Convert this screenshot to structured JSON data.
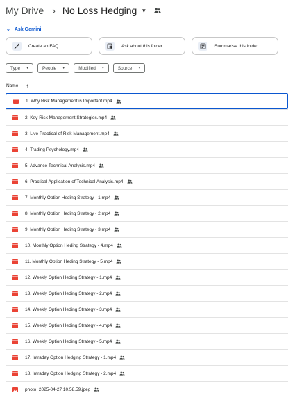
{
  "breadcrumb": {
    "root": "My Drive",
    "separator": "›",
    "current": "No Loss Hedging"
  },
  "gemini": {
    "label": "Ask Gemini"
  },
  "suggestions": [
    {
      "label": "Create an FAQ"
    },
    {
      "label": "Ask about this folder"
    },
    {
      "label": "Summarise this folder"
    }
  ],
  "filters": [
    {
      "label": "Type"
    },
    {
      "label": "People"
    },
    {
      "label": "Modified"
    },
    {
      "label": "Source"
    }
  ],
  "list_header": {
    "name_label": "Name",
    "sort": "ascending"
  },
  "files": [
    {
      "name": "1. Why Risk Management is Important.mp4",
      "kind": "video",
      "shared": true
    },
    {
      "name": "2. Key Risk Management Strategies.mp4",
      "kind": "video",
      "shared": true
    },
    {
      "name": "3. Live Practical of Risk Management.mp4",
      "kind": "video",
      "shared": true
    },
    {
      "name": "4. Trading Psychology.mp4",
      "kind": "video",
      "shared": true
    },
    {
      "name": "5. Advance Technical Analysis.mp4",
      "kind": "video",
      "shared": true
    },
    {
      "name": "6. Practical Application of Technical Analysis.mp4",
      "kind": "video",
      "shared": true
    },
    {
      "name": "7. Monthly Option Heding Strategy - 1.mp4",
      "kind": "video",
      "shared": true
    },
    {
      "name": "8. Monthly Option Heding Strategy - 2.mp4",
      "kind": "video",
      "shared": true
    },
    {
      "name": "9. Monthly Option Heding Strategy - 3.mp4",
      "kind": "video",
      "shared": true
    },
    {
      "name": "10. Monthly Option Heding Strategy - 4.mp4",
      "kind": "video",
      "shared": true
    },
    {
      "name": "11. Monthly Option Heding Strategy - 5.mp4",
      "kind": "video",
      "shared": true
    },
    {
      "name": "12. Weekly Option Heding Strategy - 1.mp4",
      "kind": "video",
      "shared": true
    },
    {
      "name": "13. Weekly Option Heding Strategy - 2.mp4",
      "kind": "video",
      "shared": true
    },
    {
      "name": "14. Weekly Option Heding Strategy - 3.mp4",
      "kind": "video",
      "shared": true
    },
    {
      "name": "15. Weekly Option Heding Strategy - 4.mp4",
      "kind": "video",
      "shared": true
    },
    {
      "name": "16. Weekly Option Heding Strategy - 5.mp4",
      "kind": "video",
      "shared": true
    },
    {
      "name": "17. Intraday Option Hedging Strategy - 1.mp4",
      "kind": "video",
      "shared": true
    },
    {
      "name": "18. Intraday Option Hedging Strategy - 2.mp4",
      "kind": "video",
      "shared": true
    },
    {
      "name": "photo_2025-04-27 10.58.59.jpeg",
      "kind": "image",
      "shared": true
    }
  ],
  "colors": {
    "accent": "#0b57d0",
    "video_icon": "#ea4335",
    "text": "#1f1f1f"
  }
}
